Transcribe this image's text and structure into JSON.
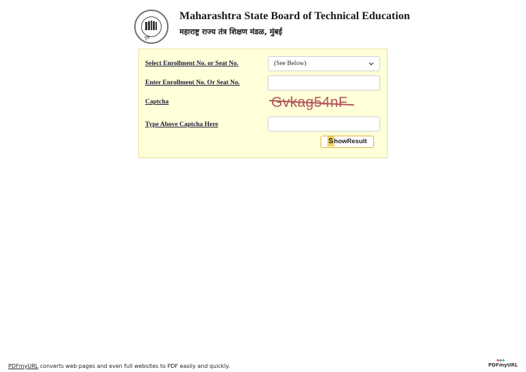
{
  "header": {
    "logo_text": "पुणे",
    "title": "Maharashtra State Board of Technical Education",
    "subtitle": "महाराष्ट्र राज्य तंत्र शिक्षण मंडळ, मुंबई"
  },
  "form": {
    "enrollment_select": {
      "label": "Select Enrollment No. or Seat No.",
      "selected": "(See Below)"
    },
    "enrollment_input": {
      "label": "Enter Enrollment No. Or Seat No.",
      "value": ""
    },
    "captcha": {
      "label": "Captcha",
      "text": "Gvkag54nF"
    },
    "captcha_input": {
      "label": "Type Above Captcha Here",
      "value": ""
    },
    "show_button": {
      "first_letter": "S",
      "rest": "howResult"
    }
  },
  "footer": {
    "link_text": "PDFmyURL",
    "text": " converts web pages and even full websites to PDF easily and quickly.",
    "brand": "PDFmyURL"
  },
  "colors": {
    "panel_bg": "#ffffd9",
    "captcha": "#b0545a",
    "button_border": "#e0b13a"
  }
}
